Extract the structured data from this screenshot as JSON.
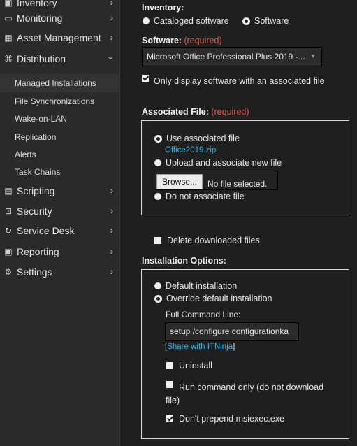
{
  "sidebar": {
    "items": [
      {
        "label": "Inventory",
        "icon": "inventory-icon"
      },
      {
        "label": "Monitoring",
        "icon": "monitor-icon"
      },
      {
        "label": "Asset Management",
        "icon": "asset-icon"
      },
      {
        "label": "Distribution",
        "icon": "distribution-icon"
      },
      {
        "label": "Scripting",
        "icon": "scripting-icon"
      },
      {
        "label": "Security",
        "icon": "lock-icon"
      },
      {
        "label": "Service Desk",
        "icon": "service-desk-icon"
      },
      {
        "label": "Reporting",
        "icon": "reporting-icon"
      },
      {
        "label": "Settings",
        "icon": "settings-icon"
      }
    ],
    "sub_items": [
      {
        "label": "Managed Installations"
      },
      {
        "label": "File Synchronizations"
      },
      {
        "label": "Wake-on-LAN"
      },
      {
        "label": "Replication"
      },
      {
        "label": "Alerts"
      },
      {
        "label": "Task Chains"
      }
    ]
  },
  "form": {
    "inventory_label": "Inventory:",
    "inventory_options": [
      "Cataloged software",
      "Software"
    ],
    "software_label": "Software:",
    "required": "(required)",
    "software_value": "Microsoft Office Professional Plus 2019 -...",
    "only_display_label": "Only display software with an associated file",
    "associated_file_label": "Associated File:",
    "assoc_options": [
      "Use associated file",
      "Upload and associate new file",
      "Do not associate file"
    ],
    "assoc_file_name": "Office2019.zip",
    "browse_label": "Browse...",
    "no_file_label": "No file selected.",
    "delete_label": "Delete downloaded files",
    "installation_options_label": "Installation Options:",
    "install_options": [
      "Default installation",
      "Override default installation"
    ],
    "full_command_label": "Full Command Line:",
    "command_value": "setup /configure configurationka",
    "share_prefix": "[",
    "share_link": "Share with ITNinja",
    "share_suffix": "]",
    "uninstall_label": "Uninstall",
    "run_only_label": "Run command only (do not download file)",
    "dont_prepend_label": "Don't prepend msiexec.exe"
  }
}
